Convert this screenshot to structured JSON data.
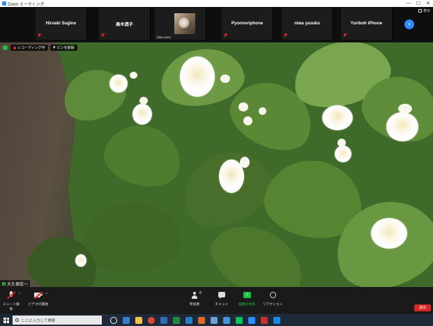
{
  "window": {
    "title": "Zoom ミーティング",
    "controls": [
      "—",
      "☐",
      "✕"
    ]
  },
  "view_toggle": {
    "label": "表示"
  },
  "participants": [
    {
      "name": "Hiroaki Sugino",
      "muted": true
    },
    {
      "name": "高木透子",
      "muted": true
    },
    {
      "name": "taka sano",
      "muted": false,
      "has_avatar": true
    },
    {
      "name": "Pyonnoriphone",
      "muted": true
    },
    {
      "name": "niwa yasuko",
      "muted": true
    },
    {
      "name": "Yuriboh iPhone",
      "muted": true
    }
  ],
  "badges": {
    "recording": "レコーディング中",
    "pin": "ピンを削除"
  },
  "active_speaker": {
    "name": "大久保宏一"
  },
  "toolbar": {
    "mute": "ミュート解除",
    "video": "ビデオの開始",
    "participants": "参加者",
    "participant_count": "8",
    "chat": "チャット",
    "share": "画面の共有",
    "reaction": "リアクション",
    "end": "退出"
  },
  "taskbar": {
    "search_placeholder": "ここに入力して検索"
  },
  "colors": {
    "accent": "#2d8cff",
    "share": "#23c147",
    "danger": "#d62828",
    "mute": "#e02828"
  }
}
